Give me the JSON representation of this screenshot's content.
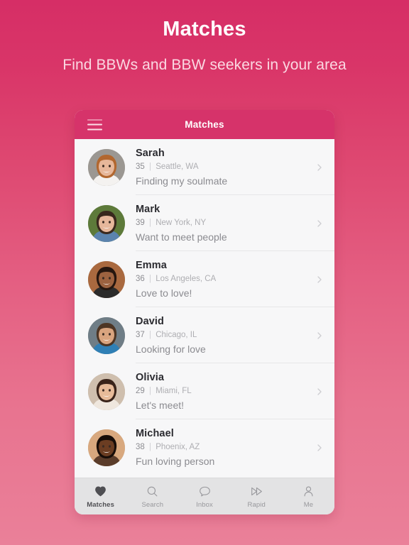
{
  "promo": {
    "title": "Matches",
    "subtitle": "Find BBWs and BBW seekers in your area"
  },
  "app": {
    "menu_icon": "hamburger-menu-icon",
    "title": "Matches"
  },
  "colors": {
    "background_top": "#d62e66",
    "background_bottom": "#ea8099",
    "appbar": "#d6336a",
    "card": "#f7f7f8",
    "nav_bar": "#e3e3e4",
    "nav_active": "#4f4f53",
    "nav_inactive": "#98989c"
  },
  "matches": [
    {
      "name": "Sarah",
      "age": "35",
      "separator": "|",
      "location": "Seattle, WA",
      "tagline": "Finding my soulmate",
      "chevron": "chevron-right-icon",
      "avatar": "avatar-sarah",
      "skin": "#e7b79a",
      "hair": "#b2672f",
      "bg": "#9b9792",
      "shirt": "#f4f2f0"
    },
    {
      "name": "Mark",
      "age": "39",
      "separator": "|",
      "location": "New York, NY",
      "tagline": "Want to meet people",
      "chevron": "chevron-right-icon",
      "avatar": "avatar-mark",
      "skin": "#e6b79b",
      "hair": "#39281d",
      "bg": "#5d7a3a",
      "shirt": "#5b83ae"
    },
    {
      "name": "Emma",
      "age": "36",
      "separator": "|",
      "location": "Los Angeles, CA",
      "tagline": "Love to love!",
      "chevron": "chevron-right-icon",
      "avatar": "avatar-emma",
      "skin": "#9c6240",
      "hair": "#25160f",
      "bg": "#a9693f",
      "shirt": "#2b2b2b"
    },
    {
      "name": "David",
      "age": "37",
      "separator": "|",
      "location": "Chicago, IL",
      "tagline": "Looking for love",
      "chevron": "chevron-right-icon",
      "avatar": "avatar-david",
      "skin": "#d9a47f",
      "hair": "#4d3524",
      "bg": "#6f7d86",
      "shirt": "#2f7fb5"
    },
    {
      "name": "Olivia",
      "age": "29",
      "separator": "|",
      "location": "Miami, FL",
      "tagline": "Let's meet!",
      "chevron": "chevron-right-icon",
      "avatar": "avatar-olivia",
      "skin": "#e7bb99",
      "hair": "#3a241a",
      "bg": "#cfbfae",
      "shirt": "#efe7de"
    },
    {
      "name": "Michael",
      "age": "38",
      "separator": "|",
      "location": "Phoenix, AZ",
      "tagline": "Fun loving person",
      "chevron": "chevron-right-icon",
      "avatar": "avatar-michael",
      "skin": "#6b3d22",
      "hair": "#170d08",
      "bg": "#d8a87e",
      "shirt": "#5a3c2a"
    }
  ],
  "bottom_nav": [
    {
      "label": "Matches",
      "icon": "heart-icon",
      "active": true
    },
    {
      "label": "Search",
      "icon": "search-icon",
      "active": false
    },
    {
      "label": "Inbox",
      "icon": "speech-bubble-icon",
      "active": false
    },
    {
      "label": "Rapid",
      "icon": "double-chevron-icon",
      "active": false
    },
    {
      "label": "Me",
      "icon": "person-icon",
      "active": false
    }
  ]
}
